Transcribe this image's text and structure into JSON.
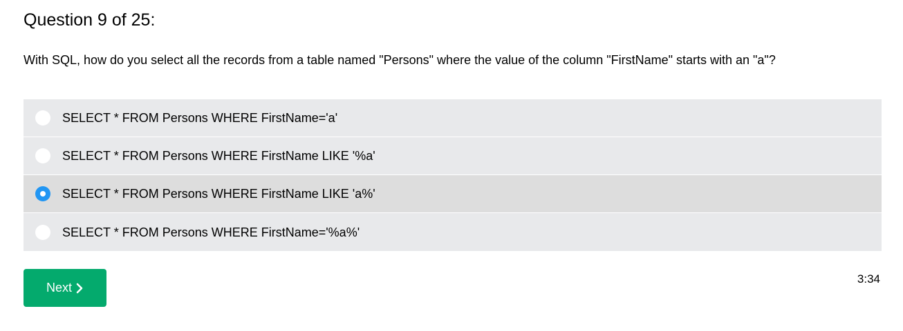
{
  "quiz": {
    "title": "Question 9 of 25:",
    "question": "With SQL, how do you select all the records from a table named \"Persons\" where the value of the column \"FirstName\" starts with an \"a\"?",
    "options": [
      {
        "label": "SELECT * FROM Persons WHERE FirstName='a'",
        "selected": false
      },
      {
        "label": "SELECT * FROM Persons WHERE FirstName LIKE '%a'",
        "selected": false
      },
      {
        "label": "SELECT * FROM Persons WHERE FirstName LIKE 'a%'",
        "selected": true
      },
      {
        "label": "SELECT * FROM Persons WHERE FirstName='%a%'",
        "selected": false
      }
    ],
    "next_label": "Next",
    "next_icon": "chevron-right-icon",
    "timer": "3:34"
  },
  "colors": {
    "option_bg": "#e8e9eb",
    "option_selected_bg": "#dddddd",
    "radio_checked": "#2196f3",
    "next_button_bg": "#04aa6d"
  }
}
